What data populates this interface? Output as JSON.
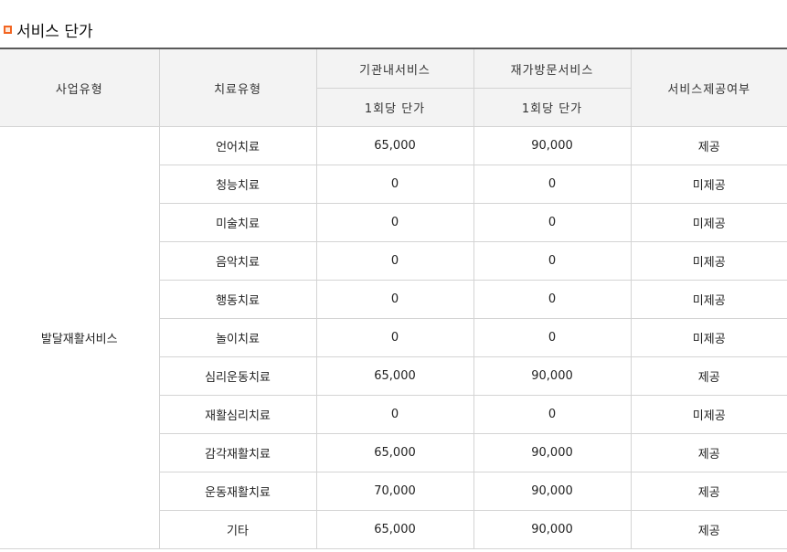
{
  "section": {
    "title": "서비스 단가"
  },
  "table": {
    "headers": {
      "business_type": "사업유형",
      "treatment_type": "치료유형",
      "in_facility": "기관내서비스",
      "home_visit": "재가방문서비스",
      "unit_price_in": "1회당 단가",
      "unit_price_home": "1회당 단가",
      "provided": "서비스제공여부"
    },
    "business_type": "발달재활서비스",
    "rows": [
      {
        "treatment": "언어치료",
        "in_facility": "65,000",
        "home_visit": "90,000",
        "provided": "제공"
      },
      {
        "treatment": "청능치료",
        "in_facility": "0",
        "home_visit": "0",
        "provided": "미제공"
      },
      {
        "treatment": "미술치료",
        "in_facility": "0",
        "home_visit": "0",
        "provided": "미제공"
      },
      {
        "treatment": "음악치료",
        "in_facility": "0",
        "home_visit": "0",
        "provided": "미제공"
      },
      {
        "treatment": "행동치료",
        "in_facility": "0",
        "home_visit": "0",
        "provided": "미제공"
      },
      {
        "treatment": "놀이치료",
        "in_facility": "0",
        "home_visit": "0",
        "provided": "미제공"
      },
      {
        "treatment": "심리운동치료",
        "in_facility": "65,000",
        "home_visit": "90,000",
        "provided": "제공"
      },
      {
        "treatment": "재활심리치료",
        "in_facility": "0",
        "home_visit": "0",
        "provided": "미제공"
      },
      {
        "treatment": "감각재활치료",
        "in_facility": "65,000",
        "home_visit": "90,000",
        "provided": "제공"
      },
      {
        "treatment": "운동재활치료",
        "in_facility": "70,000",
        "home_visit": "90,000",
        "provided": "제공"
      },
      {
        "treatment": "기타",
        "in_facility": "65,000",
        "home_visit": "90,000",
        "provided": "제공"
      }
    ]
  },
  "colors": {
    "bullet": "#f26522",
    "header_bg": "#f3f3f3",
    "border": "#d4d4d4"
  }
}
